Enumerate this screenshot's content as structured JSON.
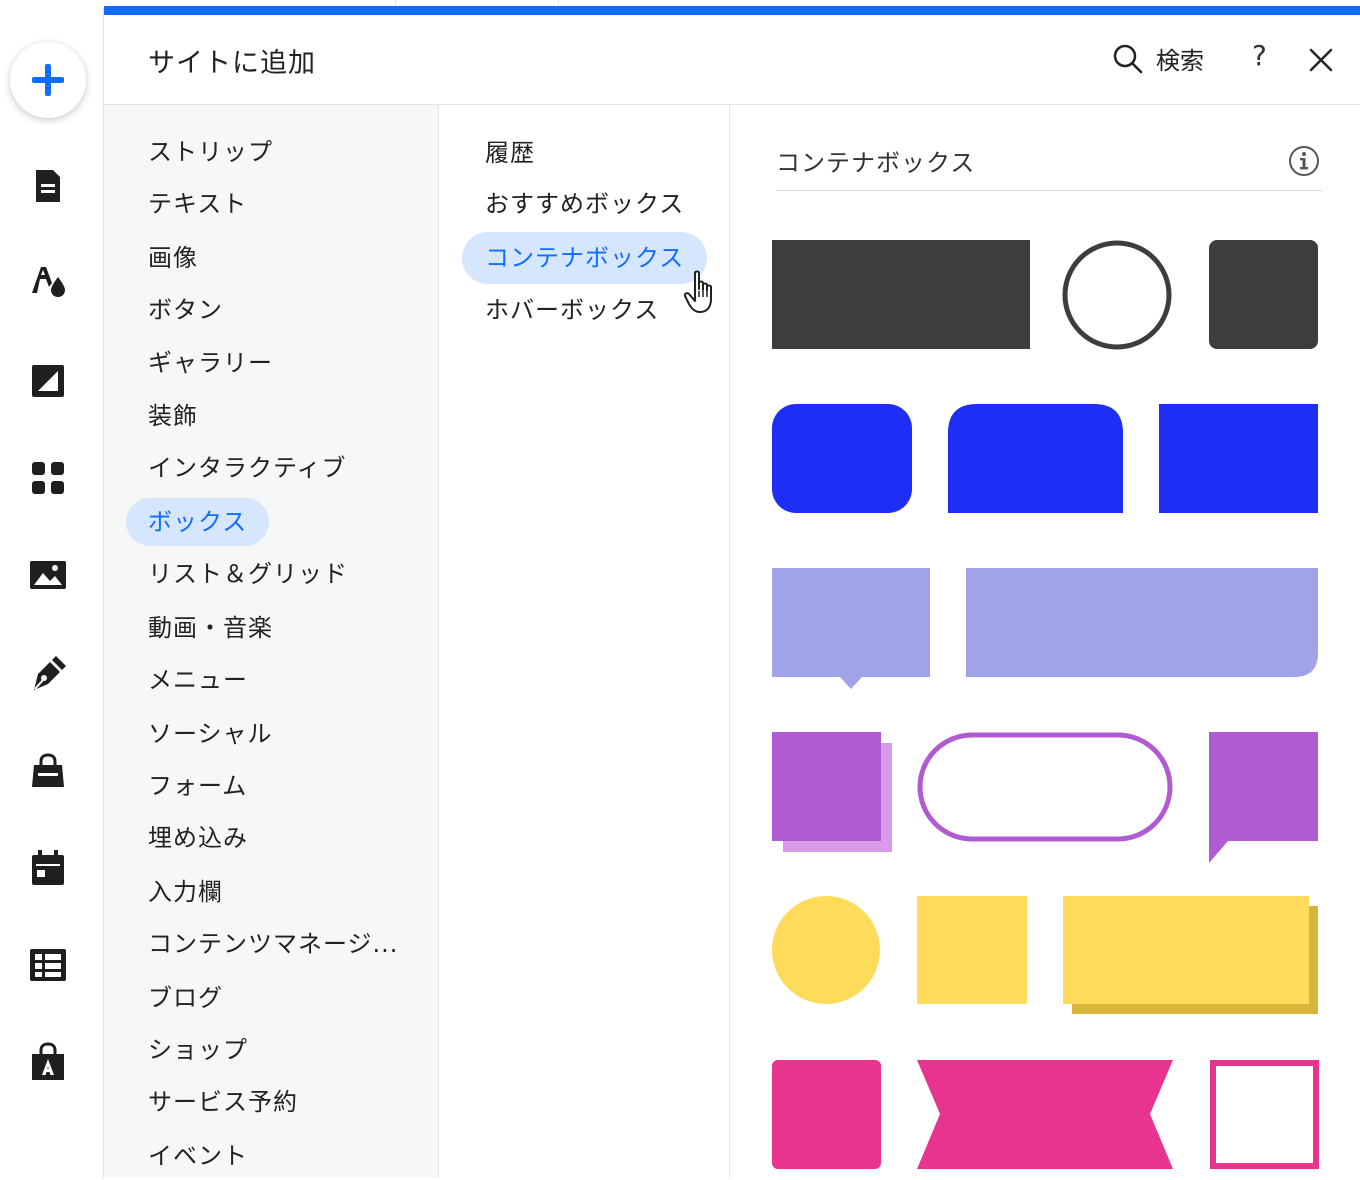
{
  "header": {
    "title": "サイトに追加",
    "search_label": "検索",
    "help_label": "?"
  },
  "rail": {
    "icons": [
      "add-icon",
      "pages-icon",
      "theme-icon",
      "background-icon",
      "apps-icon",
      "media-icon",
      "pen-icon",
      "store-icon",
      "calendar-icon",
      "table-icon",
      "app-market-icon"
    ]
  },
  "categories": [
    "ストリップ",
    "テキスト",
    "画像",
    "ボタン",
    "ギャラリー",
    "装飾",
    "インタラクティブ",
    "ボックス",
    "リスト＆グリッド",
    "動画・音楽",
    "メニュー",
    "ソーシャル",
    "フォーム",
    "埋め込み",
    "入力欄",
    "コンテンツマネージ...",
    "ブログ",
    "ショップ",
    "サービス予約",
    "イベント"
  ],
  "active_category": "ボックス",
  "subcategories": [
    "履歴",
    "おすすめボックス",
    "コンテナボックス",
    "ホバーボックス"
  ],
  "active_subcategory": "コンテナボックス",
  "gallery": {
    "title": "コンテナボックス",
    "colors": {
      "dark": "#3d3d3d",
      "blue": "#1f2ef5",
      "lavender": "#a0a3e8",
      "purple": "#b15bd3",
      "purple_light": "#d99be8",
      "yellow": "#ffdb5c",
      "yellow_shadow": "#d8b53b",
      "pink": "#e7348f"
    }
  },
  "accent_color": "#116dff"
}
